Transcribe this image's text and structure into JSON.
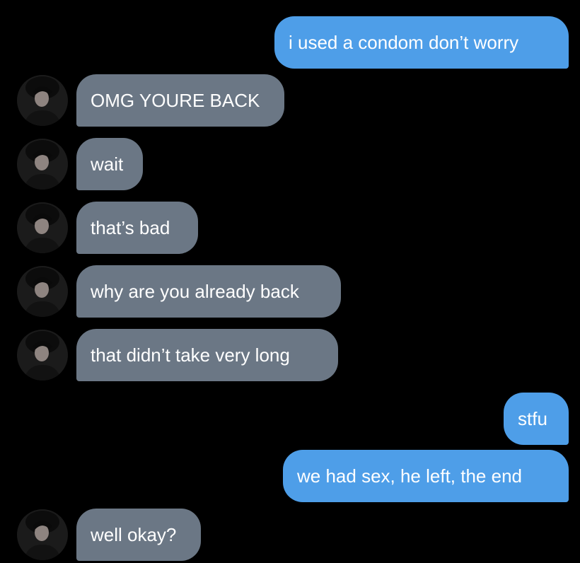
{
  "messages": [
    {
      "from": "me",
      "text": "i used a condom don’t worry"
    },
    {
      "from": "them",
      "text": "OMG YOURE BACK"
    },
    {
      "from": "them",
      "text": "wait"
    },
    {
      "from": "them",
      "text": "that’s bad"
    },
    {
      "from": "them",
      "text": "why are you already back"
    },
    {
      "from": "them",
      "text": "that didn’t take very long"
    },
    {
      "from": "me",
      "text": "stfu"
    },
    {
      "from": "me",
      "text": "we had sex, he left, the end"
    },
    {
      "from": "them",
      "text": "well okay?"
    }
  ],
  "colors": {
    "background": "#000000",
    "sent_bubble": "#4e9ee8",
    "received_bubble": "#6b7785",
    "text": "#ffffff"
  },
  "icons": {
    "avatar": "contact-avatar-photo"
  }
}
